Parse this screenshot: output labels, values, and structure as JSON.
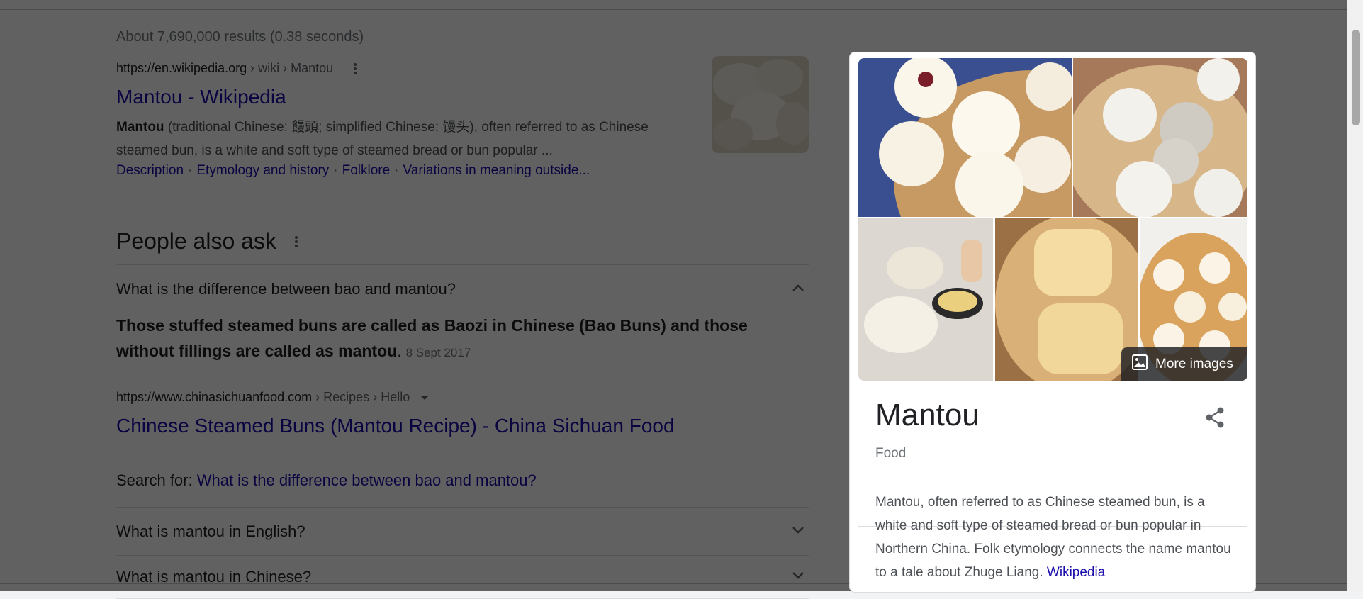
{
  "stats": "About 7,690,000 results (0.38 seconds)",
  "first_result": {
    "url": "https://en.wikipedia.org",
    "breadcrumb": "› wiki › Mantou",
    "title": "Mantou - Wikipedia",
    "snippet_bold": "Mantou",
    "snippet_rest": " (traditional Chinese: 饅頭; simplified Chinese: 馒头), often referred to as Chinese steamed bun, is a white and soft type of steamed bread or bun popular ...",
    "sitelinks": [
      "Description",
      "Etymology and history",
      "Folklore",
      "Variations in meaning outside..."
    ]
  },
  "people_also_ask": {
    "heading": "People also ask",
    "q1": "What is the difference between bao and mantou?",
    "answer_bold": "Those stuffed steamed buns are called as Baozi in Chinese (Bao Buns) and those without fillings are called as mantou",
    "answer_period": ".",
    "answer_date": "8 Sept 2017",
    "source_url": "https://www.chinasichuanfood.com",
    "source_breadcrumb": "› Recipes › Hello",
    "source_title": "Chinese Steamed Buns (Mantou Recipe) - China Sichuan Food",
    "search_for_label": "Search for: ",
    "search_for_link": "What is the difference between bao and mantou?",
    "q2": "What is mantou in English?",
    "q3": "What is mantou in Chinese?"
  },
  "knowledge_panel": {
    "more_images": "More images",
    "title": "Mantou",
    "subtitle": "Food",
    "description": "Mantou, often referred to as Chinese steamed bun, is a white and soft type of steamed bread or bun popular in Northern China. Folk etymology connects the name mantou to a tale about Zhuge Liang. ",
    "source_link": "Wikipedia"
  },
  "icons": {
    "more_options": "kebab-icon",
    "expand": "chevron-icon",
    "share": "share-icon",
    "images": "image-icon"
  },
  "colors": {
    "link": "#1a0dab",
    "text": "#202124",
    "secondary": "#70757a",
    "overlay": "rgba(0,0,0,0.62)"
  }
}
